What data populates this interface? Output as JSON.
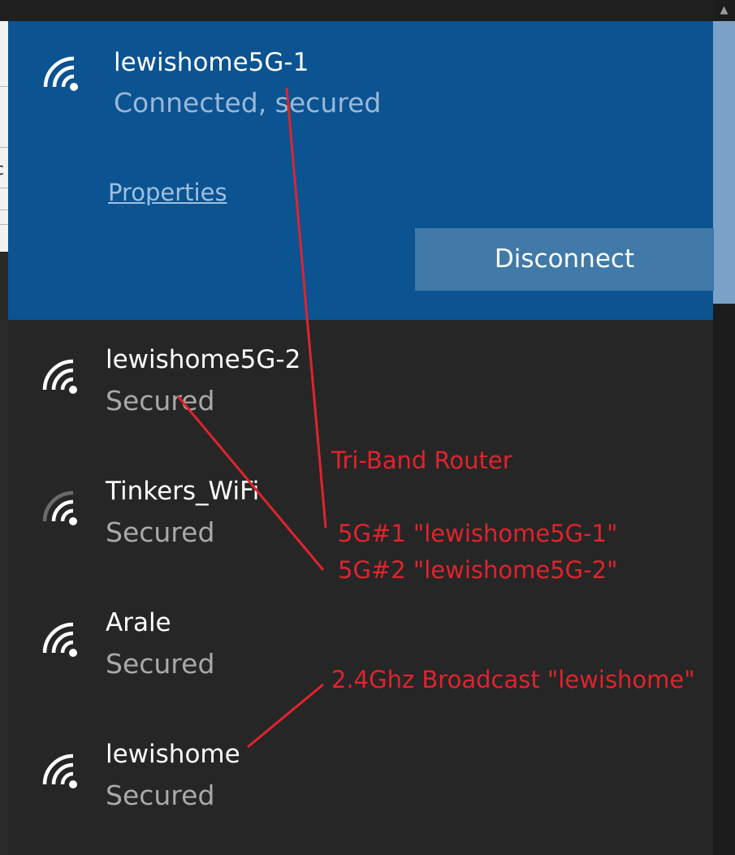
{
  "connected_network": {
    "name": "lewishome5G-1",
    "status": "Connected, secured",
    "properties_label": "Properties",
    "disconnect_label": "Disconnect",
    "icon": "wifi-icon"
  },
  "networks": [
    {
      "name": "lewishome5G-2",
      "status": "Secured",
      "icon": "wifi-icon",
      "signal_bars": 4
    },
    {
      "name": "Tinkers_WiFi",
      "status": "Secured",
      "icon": "wifi-icon",
      "signal_bars": 3
    },
    {
      "name": "Arale",
      "status": "Secured",
      "icon": "wifi-icon",
      "signal_bars": 4
    },
    {
      "name": "lewishome",
      "status": "Secured",
      "icon": "wifi-icon",
      "signal_bars": 4
    }
  ],
  "annotations": {
    "router": "Tri-Band Router",
    "band1": "5G#1 \"lewishome5G-1\"",
    "band2": "5G#2 \"lewishome5G-2\"",
    "band24": "2.4Ghz Broadcast \"lewishome\""
  },
  "colors": {
    "connected_bg": "#0b5391",
    "panel_bg": "#262626",
    "annotation": "#e0232d",
    "disconnect_bg": "#4179a8"
  },
  "scrollbar": {
    "up_arrow_icon": "chevron-up-icon"
  }
}
